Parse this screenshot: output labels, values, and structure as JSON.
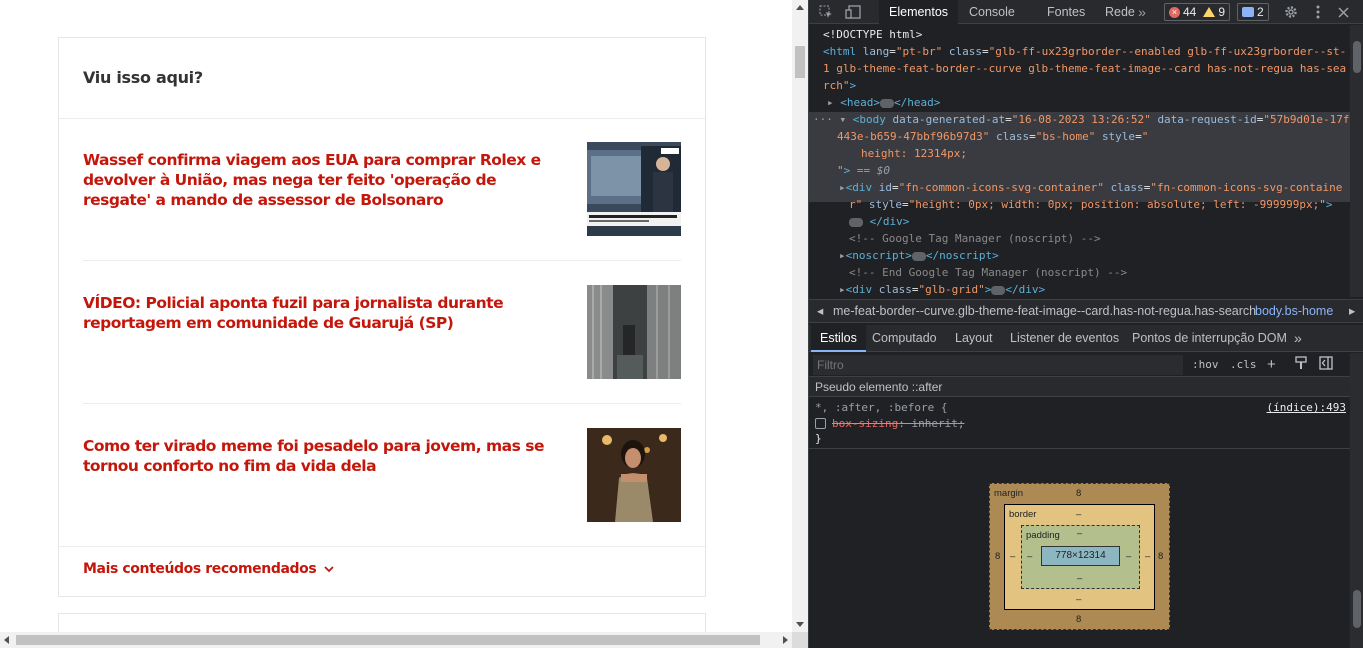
{
  "page": {
    "section_title": "Viu isso aqui?",
    "items": [
      {
        "title": "Wassef confirma viagem aos EUA para comprar Rolex e devolver à União, mas nega ter feito 'operação de resgate' a mando de assessor de Bolsonaro"
      },
      {
        "title": "VÍDEO: Policial aponta fuzil para jornalista durante reportagem em comunidade de Guarujá (SP)"
      },
      {
        "title": "Como ter virado meme foi pesadelo para jovem, mas se tornou conforto no fim da vida dela"
      }
    ],
    "more_link": "Mais conteúdos recomendados",
    "accent_color": "#c4170c"
  },
  "devtools": {
    "tabs": [
      "Elementos",
      "Console",
      "Fontes",
      "Rede"
    ],
    "active_tab": "Elementos",
    "more_tabs_glyph": "»",
    "errors": "44",
    "warnings": "9",
    "messages": "2",
    "dom": {
      "doctype": "<!DOCTYPE html>",
      "html_lang": "pt-br",
      "html_class_1": "glb-ff-ux23grborder--enabled glb-ff-ux23grborder--st-",
      "html_class_2": "1 glb-theme-feat-border--curve glb-theme-feat-image--card has-not-regua has-sea",
      "html_class_3": "rch",
      "head": "head",
      "body_generated_at": "16-08-2023 13:26:52",
      "body_request_id_1": "57b9d01e-17ff-",
      "body_request_id_2": "443e-b659-47bbf96b97d3",
      "body_class": "bs-home",
      "body_style": "height: 12314px;",
      "selected_marker": "== $0",
      "icons_div_id": "fn-common-icons-svg-container",
      "icons_div_class_1": "fn-common-icons-svg-containe",
      "icons_div_class_2": "r",
      "icons_div_style": "height: 0px; width: 0px; position: absolute; left: -999999px;",
      "comment_gtm": "<!-- Google Tag Manager (noscript) -->",
      "noscript": "noscript",
      "comment_gtm_end": "<!-- End Google Tag Manager (noscript) -->",
      "grid_div_class": "glb-grid"
    },
    "breadcrumbs": {
      "first": "me-feat-border--curve.glb-theme-feat-image--card.has-not-regua.has-search",
      "active": "body.bs-home"
    },
    "sub_tabs": [
      "Estilos",
      "Computado",
      "Layout",
      "Listener de eventos",
      "Pontos de interrupção DOM"
    ],
    "active_sub_tab": "Estilos",
    "sub_tabs_more": "»",
    "filter_placeholder": "Filtro",
    "hov": ":hov",
    "cls": ".cls",
    "pseudo_header": "Pseudo elemento ::after",
    "rule": {
      "selector": "*, :after, :before {",
      "source": "(índice):493",
      "property": "box-sizing",
      "value": "inherit",
      "close": "}"
    },
    "box_model": {
      "margin_label": "margin",
      "border_label": "border",
      "padding_label": "padding",
      "margin_top": "8",
      "margin_bottom": "8",
      "margin_left": "8",
      "margin_right": "8",
      "border_top": "–",
      "border_bottom": "–",
      "border_left": "–",
      "border_right": "–",
      "padding_top": "–",
      "padding_bottom": "–",
      "padding_left": "–",
      "padding_right": "–",
      "content": "778×12314"
    }
  }
}
